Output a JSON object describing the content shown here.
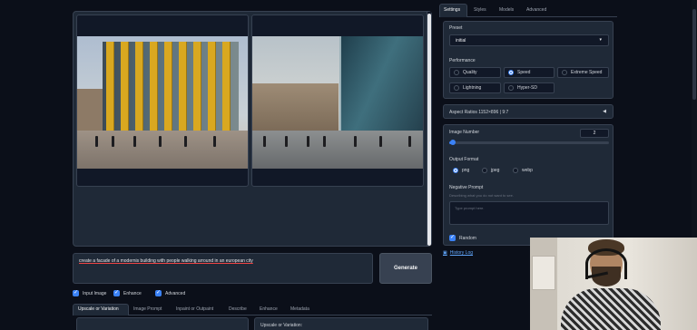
{
  "gallery": {},
  "prompt": {
    "value": "create a facade of a modernis building with people walking arround in an european city"
  },
  "generate_label": "Generate",
  "options": [
    {
      "label": "Input Image",
      "checked": true
    },
    {
      "label": "Enhance",
      "checked": true
    },
    {
      "label": "Advanced",
      "checked": true
    }
  ],
  "bottom_tabs": [
    "Upscale or Variation",
    "Image Prompt",
    "Inpaint or Outpaint",
    "Describe",
    "Enhance",
    "Metadata"
  ],
  "upscale_label": "Upscale or Variation:",
  "right_tabs": [
    "Settings",
    "Styles",
    "Models",
    "Advanced"
  ],
  "settings": {
    "preset_label": "Preset",
    "preset_value": "initial",
    "performance_label": "Performance",
    "performance_options": [
      "Quality",
      "Speed",
      "Extreme Speed",
      "Lightning",
      "Hyper-SD"
    ],
    "performance_selected": "Speed",
    "aspect_label": "Aspect Ratios 1152×896 | 9:7",
    "image_number_label": "Image Number",
    "image_number_value": "2",
    "output_format_label": "Output Format",
    "output_formats": [
      "png",
      "jpeg",
      "webp"
    ],
    "output_format_selected": "png",
    "negative_prompt_label": "Negative Prompt",
    "negative_prompt_hint": "Describing what you do not want to see.",
    "negative_prompt_placeholder": "Type prompt here.",
    "random_label": "Random",
    "random_checked": true
  },
  "history_link": "History Log",
  "colors": {
    "accent": "#3b82f6",
    "background": "#0b0f19",
    "panel": "#1f2937",
    "fin": "#d9a820"
  }
}
